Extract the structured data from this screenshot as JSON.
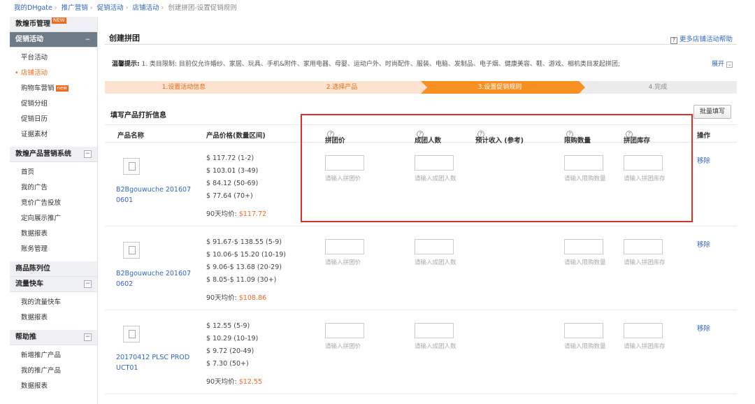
{
  "breadcrumb": [
    "我的DHgate",
    "推广营销",
    "促销活动",
    "店铺活动",
    "创建拼团-设置促销规则"
  ],
  "sidebar": {
    "sections": [
      {
        "label": "敦煌币管理",
        "badge": "NEW",
        "items": []
      },
      {
        "label": "促销活动",
        "active": true,
        "toggle": "−",
        "items": [
          {
            "label": "平台活动"
          },
          {
            "label": "店铺活动",
            "current": true
          },
          {
            "label": "购物车营销",
            "badge": "new"
          },
          {
            "label": "促销分组"
          },
          {
            "label": "促销日历"
          },
          {
            "label": "证据素材"
          }
        ]
      },
      {
        "label": "敦煌产品营销系统",
        "toggle": "−",
        "items": [
          {
            "label": "首页"
          },
          {
            "label": "我的广告"
          },
          {
            "label": "竞价广告投放"
          },
          {
            "label": "定向展示推广"
          },
          {
            "label": "数据报表"
          },
          {
            "label": "账务管理"
          }
        ]
      },
      {
        "label": "商品陈列位",
        "items": []
      },
      {
        "label": "流量快车",
        "toggle": "−",
        "items": [
          {
            "label": "我的流量快车"
          },
          {
            "label": "数据报表"
          }
        ]
      },
      {
        "label": "帮助推",
        "toggle": "−",
        "items": [
          {
            "label": "新增推广产品"
          },
          {
            "label": "我的推广产品"
          },
          {
            "label": "数据报表"
          }
        ]
      }
    ]
  },
  "main": {
    "title": "创建拼团",
    "help_link": "更多店铺活动帮助",
    "tips_label": "温馨提示:",
    "tips_text": "1. 类目限制: 目前仅允许婚纱、家居、玩具、手机&附件、家用电器、母婴、运动户外、时尚配件、服装、电脑、发制品、电子烟、健康美容、鞋、游戏、相机类目发起拼团;",
    "expand_label": "展开",
    "steps": [
      {
        "label": "1.设置活动信息",
        "state": "done"
      },
      {
        "label": "2.选择产品",
        "state": "done"
      },
      {
        "label": "3.设置促销规则",
        "state": "current"
      },
      {
        "label": "4.完成",
        "state": "todo"
      }
    ],
    "section_title": "填写产品打折信息",
    "batch_button": "批量填写",
    "columns": {
      "name": "产品名称",
      "price": "产品价格(数量区间)",
      "group_price": "拼团价",
      "group_size": "成团人数",
      "income": "预计收入 (参考)",
      "limit": "限购数量",
      "stock": "拼团库存",
      "action": "操作"
    },
    "placeholders": {
      "group_price": "请输入拼团价",
      "group_size": "请输入成团人数",
      "limit": "请输入限购数量",
      "stock": "请输入拼团库存"
    },
    "avg_label": "90天均价:",
    "remove_label": "移除",
    "rows": [
      {
        "name": "B2Bgouwuche 2016070601",
        "prices": [
          "$ 117.72 (1-2)",
          "$ 103.01 (3-49)",
          "$ 84.12 (50-69)",
          "$ 77.64 (70+)"
        ],
        "avg": "$117.72"
      },
      {
        "name": "B2Bgouwuche 2016070602",
        "prices": [
          "$ 91.67-$ 138.55 (5-9)",
          "$ 10.06-$ 15.20 (10-19)",
          "$ 9.06-$ 13.68 (20-29)",
          "$ 8.05-$ 11.09 (30+)"
        ],
        "avg": "$108.86"
      },
      {
        "name": "20170412 PLSC PRODUCT01",
        "prices": [
          "$ 12.55 (5-9)",
          "$ 10.29 (10-19)",
          "$ 9.72 (20-49)",
          "$ 7.30 (50+)"
        ],
        "avg": "$12.55"
      }
    ]
  },
  "colors": {
    "accent": "#f78f21",
    "link": "#2f66c2",
    "highlight": "#d9302b"
  }
}
